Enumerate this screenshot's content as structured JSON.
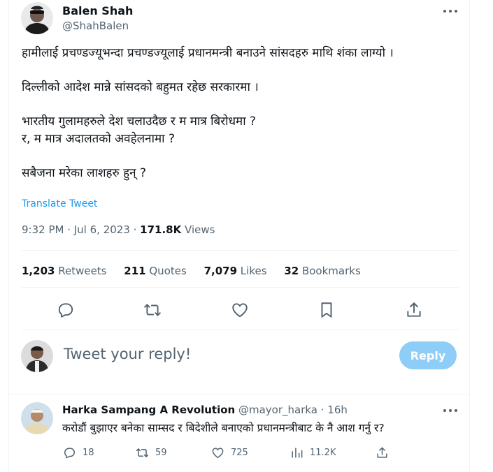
{
  "colors": {
    "accent": "#1d9bf0",
    "reply_button_disabled": "#8ecdf7",
    "muted": "#536471",
    "text": "#0f1419"
  },
  "tweet": {
    "author_name": "Balen Shah",
    "author_handle": "@ShahBalen",
    "lines": [
      "हामीलाई प्रचण्डज्यूभन्दा प्रचण्डज्यूलाई प्रधानमन्त्री बनाउने सांसदहरु माथि शंका लाग्यो ।",
      "दिल्लीको आदेश मान्ने सांसदको बहुमत रहेछ सरकारमा ।",
      "भारतीय गुलामहरुले देश चलाउदैछ र म मात्र बिरोधमा ?",
      "र, म मात्र अदालतको अवहेलनामा ?",
      "सबैजना मरेका लाशहरु हुन् ?"
    ],
    "translate_label": "Translate Tweet",
    "timestamp": "9:32 PM · Jul 6, 2023 · ",
    "views_count": "171.8K",
    "views_label": " Views",
    "stats": [
      {
        "count": "1,203",
        "label": " Retweets"
      },
      {
        "count": "211",
        "label": " Quotes"
      },
      {
        "count": "7,079",
        "label": " Likes"
      },
      {
        "count": "32",
        "label": " Bookmarks"
      }
    ],
    "actions": [
      "reply-icon",
      "retweet-icon",
      "like-icon",
      "bookmark-icon",
      "share-icon"
    ]
  },
  "composer": {
    "placeholder": "Tweet your reply!",
    "button_label": "Reply"
  },
  "reply": {
    "author_name": "Harka Sampang A Revolution",
    "author_handle": " @mayor_harka",
    "time": " · 16h",
    "text": "करोडौं बुझाएर बनेका साम्सद र बिदेशीले बनाएको प्रधानमन्त्रीबाट के नै आश गर्नु र?",
    "counts": {
      "replies": "18",
      "retweets": "59",
      "likes": "725",
      "views": "11.2K"
    }
  }
}
